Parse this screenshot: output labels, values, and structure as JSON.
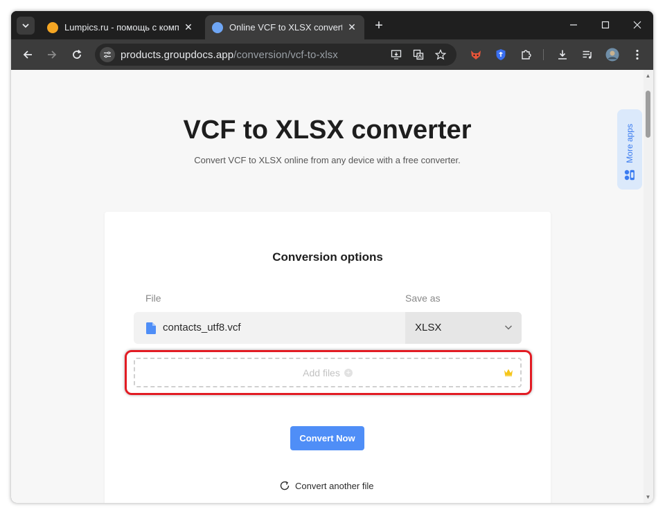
{
  "browser": {
    "tabs": [
      {
        "title": "Lumpics.ru - помощь с компьютером",
        "favicon_color": "#f5a623",
        "active": false
      },
      {
        "title": "Online VCF to XLSX converter | Free GroupDocs Apps",
        "favicon_color": "#6fa6f5",
        "active": true
      }
    ],
    "url_host": "products.groupdocs.app",
    "url_path": "/conversion/vcf-to-xlsx"
  },
  "page": {
    "title": "VCF to XLSX converter",
    "subtitle": "Convert VCF to XLSX online from any device with a free converter.",
    "more_apps_label": "More apps",
    "card": {
      "title": "Conversion options",
      "file_header": "File",
      "save_as_header": "Save as",
      "file_name": "contacts_utf8.vcf",
      "format_value": "XLSX",
      "add_files_label": "Add files",
      "convert_button": "Convert Now",
      "convert_another": "Convert another file"
    }
  },
  "colors": {
    "accent": "#4f8ef7",
    "highlight": "#e21b23",
    "more_apps_bg": "#dbe9fb"
  }
}
